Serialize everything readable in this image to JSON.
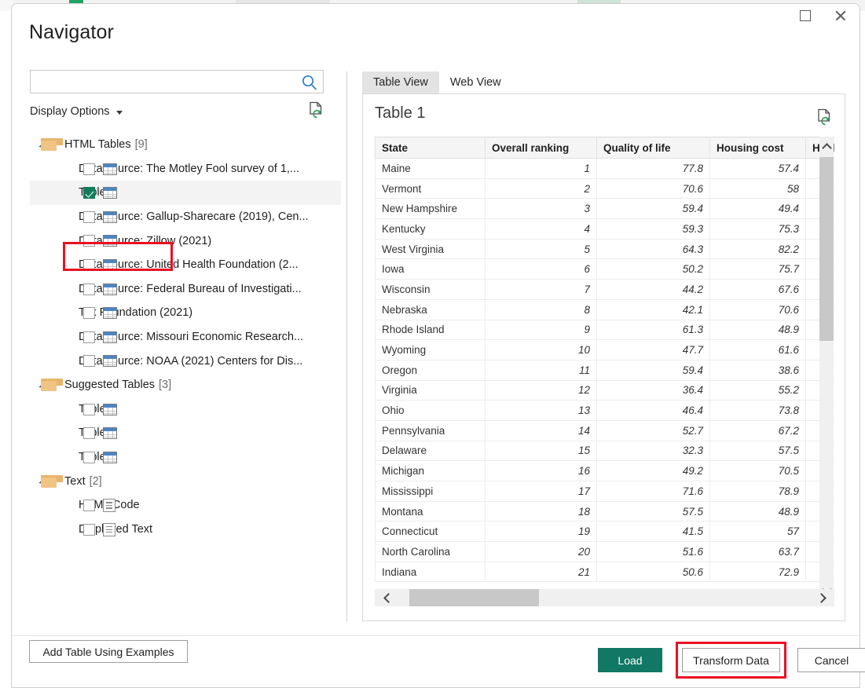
{
  "window": {
    "title": "Navigator",
    "controls": [
      {
        "name": "maximize-button",
        "icon": "maximize-icon"
      },
      {
        "name": "close-button",
        "icon": "close-icon"
      }
    ]
  },
  "left_panel": {
    "search": {
      "value": "",
      "placeholder": "",
      "icon": "search-icon"
    },
    "display_options_label": "Display Options",
    "refresh_icon": "refresh-document-icon",
    "tree": [
      {
        "type": "group",
        "label": "HTML Tables",
        "count": "[9]",
        "expanded": true,
        "children": [
          {
            "label": "Data source: The Motley Fool survey of 1,...",
            "checked": false,
            "icon": "table-icon"
          },
          {
            "label": "Table 1",
            "checked": true,
            "icon": "table-icon",
            "selected": true,
            "highlighted": true
          },
          {
            "label": "Data source: Gallup-Sharecare (2019), Cen...",
            "checked": false,
            "icon": "table-icon"
          },
          {
            "label": "Data source: Zillow (2021)",
            "checked": false,
            "icon": "table-icon"
          },
          {
            "label": "Data source: United Health Foundation (2...",
            "checked": false,
            "icon": "table-icon"
          },
          {
            "label": "Data source: Federal Bureau of Investigati...",
            "checked": false,
            "icon": "table-icon"
          },
          {
            "label": "Tax Foundation (2021)",
            "checked": false,
            "icon": "table-icon"
          },
          {
            "label": "Data source: Missouri Economic Research...",
            "checked": false,
            "icon": "table-icon"
          },
          {
            "label": "Data source: NOAA (2021) Centers for Dis...",
            "checked": false,
            "icon": "table-icon"
          }
        ]
      },
      {
        "type": "group",
        "label": "Suggested Tables",
        "count": "[3]",
        "expanded": true,
        "children": [
          {
            "label": "Table 2",
            "checked": false,
            "icon": "table-icon"
          },
          {
            "label": "Table 3",
            "checked": false,
            "icon": "table-icon"
          },
          {
            "label": "Table 4",
            "checked": false,
            "icon": "table-icon"
          }
        ]
      },
      {
        "type": "group",
        "label": "Text",
        "count": "[2]",
        "expanded": true,
        "children": [
          {
            "label": "HTML Code",
            "checked": false,
            "icon": "text-document-icon"
          },
          {
            "label": "Displayed Text",
            "checked": false,
            "icon": "text-document-icon"
          }
        ]
      }
    ]
  },
  "right_panel": {
    "tabs": [
      {
        "label": "Table View",
        "active": true
      },
      {
        "label": "Web View",
        "active": false
      }
    ],
    "preview_title": "Table 1",
    "refresh_icon": "refresh-document-icon",
    "grid": {
      "columns": [
        "State",
        "Overall ranking",
        "Quality of life",
        "Housing cost",
        "Health"
      ],
      "rows": [
        [
          "Maine",
          "1",
          "77.8",
          "57.4",
          ""
        ],
        [
          "Vermont",
          "2",
          "70.6",
          "58",
          ""
        ],
        [
          "New Hampshire",
          "3",
          "59.4",
          "49.4",
          ""
        ],
        [
          "Kentucky",
          "4",
          "59.3",
          "75.3",
          ""
        ],
        [
          "West Virginia",
          "5",
          "64.3",
          "82.2",
          ""
        ],
        [
          "Iowa",
          "6",
          "50.2",
          "75.7",
          ""
        ],
        [
          "Wisconsin",
          "7",
          "44.2",
          "67.6",
          ""
        ],
        [
          "Nebraska",
          "8",
          "42.1",
          "70.6",
          ""
        ],
        [
          "Rhode Island",
          "9",
          "61.3",
          "48.9",
          ""
        ],
        [
          "Wyoming",
          "10",
          "47.7",
          "61.6",
          ""
        ],
        [
          "Oregon",
          "11",
          "59.4",
          "38.6",
          ""
        ],
        [
          "Virginia",
          "12",
          "36.4",
          "55.2",
          ""
        ],
        [
          "Ohio",
          "13",
          "46.4",
          "73.8",
          ""
        ],
        [
          "Pennsylvania",
          "14",
          "52.7",
          "67.2",
          ""
        ],
        [
          "Delaware",
          "15",
          "32.3",
          "57.5",
          ""
        ],
        [
          "Michigan",
          "16",
          "49.2",
          "70.5",
          ""
        ],
        [
          "Mississippi",
          "17",
          "71.6",
          "78.9",
          ""
        ],
        [
          "Montana",
          "18",
          "57.5",
          "48.9",
          ""
        ],
        [
          "Connecticut",
          "19",
          "41.5",
          "57",
          ""
        ],
        [
          "North Carolina",
          "20",
          "51.6",
          "63.7",
          ""
        ],
        [
          "Indiana",
          "21",
          "50.6",
          "72.9",
          ""
        ]
      ]
    },
    "scrollbars": {
      "vertical": {
        "up_icon": "chevron-up-icon",
        "down_icon": "chevron-down-icon"
      },
      "horizontal": {
        "left_icon": "chevron-left-icon",
        "right_icon": "chevron-right-icon"
      }
    }
  },
  "footer": {
    "add_table_label": "Add Table Using Examples",
    "load_label": "Load",
    "transform_label": "Transform Data",
    "cancel_label": "Cancel"
  },
  "colors": {
    "accent_green": "#107865",
    "annotation_red": "#e81123",
    "checkbox_green": "#107c5c",
    "selected_row": "#f3f3f3",
    "folder": "#f0c485",
    "table_icon_header": "#4a86c5"
  }
}
